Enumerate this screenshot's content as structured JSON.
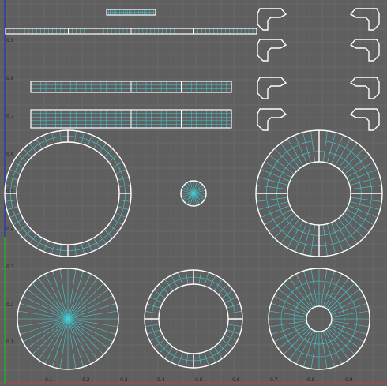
{
  "viewport": {
    "background": "#5f5f5f",
    "grid_color": "#6c6c6c",
    "wire_color": "#3fd0d8",
    "border_color": "#ffffff",
    "u_axis_color": "#c83232",
    "v_axis_color": "#2c3ca8",
    "v_axis_lower_color": "#28a828"
  },
  "axis": {
    "u_labels": [
      "0.1",
      "0.2",
      "0.3",
      "0.4",
      "0.5",
      "0.6",
      "0.7",
      "0.8",
      "0.9"
    ],
    "v_labels": [
      "0.9",
      "0.8",
      "0.7",
      "0.6",
      "0.5",
      "0.4",
      "0.3",
      "0.2",
      "0.1"
    ]
  }
}
